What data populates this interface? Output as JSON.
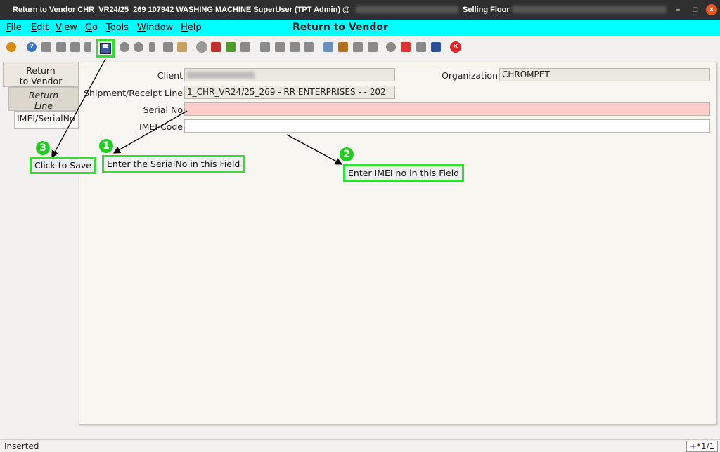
{
  "window": {
    "title": "Return to Vendor  CHR_VR24/25_269  107942  WASHING MACHINE  SuperUser (TPT Admin) @",
    "title_right": "Selling Floor",
    "controls": {
      "minimize": "–",
      "maximize": "□",
      "close": "×"
    }
  },
  "menu": {
    "items": [
      {
        "accel": "F",
        "rest": "ile"
      },
      {
        "accel": "E",
        "rest": "dit"
      },
      {
        "accel": "V",
        "rest": "iew"
      },
      {
        "accel": "G",
        "rest": "o"
      },
      {
        "accel": "T",
        "rest": "ools"
      },
      {
        "accel": "W",
        "rest": "indow"
      },
      {
        "accel": "H",
        "rest": "elp"
      }
    ],
    "window_title": "Return to Vendor"
  },
  "toolbar": {
    "icons": [
      "undo-icon",
      "help-icon",
      "new-icon",
      "copy-icon",
      "delete-icon",
      "ignore-icon",
      "save-icon",
      "refresh-icon",
      "find-icon",
      "attachment-icon",
      "chat-icon",
      "history-icon",
      "home-icon",
      "back-icon",
      "forward-icon",
      "first-icon",
      "previous-icon",
      "next-icon",
      "last-icon",
      "report-icon",
      "archive-icon",
      "print-icon",
      "print-preview-icon",
      "zoom-across-icon",
      "active-workflow-icon",
      "request-icon",
      "product-info-icon",
      "exit-icon"
    ],
    "help_glyph": "?",
    "exit_glyph": "✕"
  },
  "tabs": [
    {
      "label1": "Return",
      "label2": "to Vendor"
    },
    {
      "label1": "Return",
      "label2": "Line"
    },
    {
      "label1": "IMEI/SerialNo"
    }
  ],
  "form": {
    "client_label": "Client",
    "organization_label": "Organization",
    "organization_value": "CHROMPET",
    "shipment_label": "Shipment/Receipt Line",
    "shipment_value": "1_CHR_VR24/25_269 - RR ENTERPRISES -  - 202",
    "serial_label_underlined": "S",
    "serial_label_rest": "erial No",
    "imei_label_underlined": "I",
    "imei_label_rest": "MEI Code",
    "serial_value": "",
    "imei_value": ""
  },
  "callouts": {
    "save": {
      "number": "3",
      "text": "Click to Save"
    },
    "serial": {
      "number": "1",
      "text": "Enter the SerialNo in this Field"
    },
    "imei": {
      "number": "2",
      "text": "Enter IMEI no in this Field"
    }
  },
  "status": {
    "text": "Inserted",
    "record_plus": "+",
    "record": "*1/1"
  },
  "colors": {
    "menubar": "#00ffff",
    "highlight": "#33dd33",
    "required_field": "#ffcccc"
  }
}
